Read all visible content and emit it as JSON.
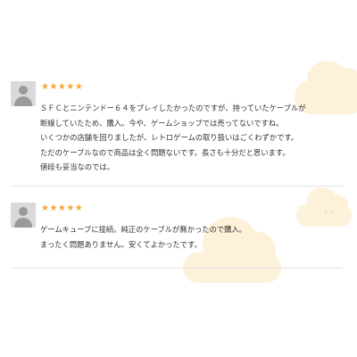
{
  "reviews": [
    {
      "stars": "★★★★★",
      "lines": [
        "ＳＦＣとニンテンドー６４をプレイしたかったのですが、持っていたケーブルが",
        "断線していたため、購入。今や、ゲームショップでは売ってないですね。",
        "いくつかの店舗を回りましたが、レトロゲームの取り扱いはごくわずかです。",
        "ただのケーブルなので商品は全く問題ないです。長さも十分だと思います。",
        "値段も妥当なのでは。"
      ]
    },
    {
      "stars": "★★★★★",
      "lines": [
        "ゲームキューブに接続。純正のケーブルが無かったので購入。",
        "まったく問題ありません。安くてよかったです。"
      ]
    }
  ],
  "colors": {
    "star": "#f3a733",
    "cloud": "#fdf1d9",
    "avatar_bg": "#d9d9d9",
    "avatar_fg": "#9a9a9a",
    "divider": "#e2e2e2"
  },
  "icons": {
    "avatar": "user-silhouette-icon",
    "rating": "star-icon"
  }
}
